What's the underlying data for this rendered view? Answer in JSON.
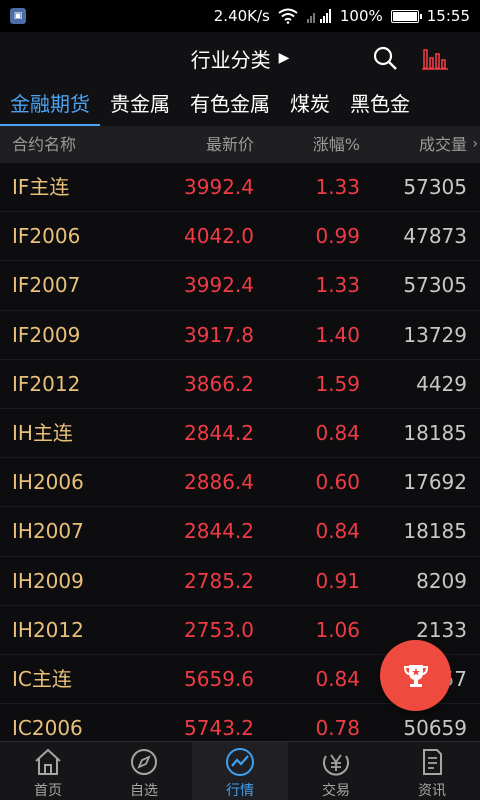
{
  "status_bar": {
    "speed": "2.40K/s",
    "battery": "100%",
    "battery_level": 1.0,
    "time": "15:55",
    "icons": [
      "app-notification-icon",
      "wifi-icon",
      "signal-icon",
      "battery-icon"
    ]
  },
  "title_bar": {
    "title": "行业分类",
    "icons": [
      "search-icon",
      "bar-chart-icon"
    ]
  },
  "tabs": [
    {
      "label": "金融期货",
      "active": true
    },
    {
      "label": "贵金属",
      "active": false
    },
    {
      "label": "有色金属",
      "active": false
    },
    {
      "label": "煤炭",
      "active": false
    },
    {
      "label": "黑色金",
      "active": false
    }
  ],
  "table": {
    "headers": {
      "name": "合约名称",
      "price": "最新价",
      "change": "涨幅%",
      "volume": "成交量"
    },
    "rows": [
      {
        "name": "IF主连",
        "price": "3992.4",
        "change": "1.33",
        "volume": "57305"
      },
      {
        "name": "IF2006",
        "price": "4042.0",
        "change": "0.99",
        "volume": "47873"
      },
      {
        "name": "IF2007",
        "price": "3992.4",
        "change": "1.33",
        "volume": "57305"
      },
      {
        "name": "IF2009",
        "price": "3917.8",
        "change": "1.40",
        "volume": "13729"
      },
      {
        "name": "IF2012",
        "price": "3866.2",
        "change": "1.59",
        "volume": "4429"
      },
      {
        "name": "IH主连",
        "price": "2844.2",
        "change": "0.84",
        "volume": "18185"
      },
      {
        "name": "IH2006",
        "price": "2886.4",
        "change": "0.60",
        "volume": "17692"
      },
      {
        "name": "IH2007",
        "price": "2844.2",
        "change": "0.84",
        "volume": "18185"
      },
      {
        "name": "IH2009",
        "price": "2785.2",
        "change": "0.91",
        "volume": "8209"
      },
      {
        "name": "IH2012",
        "price": "2753.0",
        "change": "1.06",
        "volume": "2133"
      },
      {
        "name": "IC主连",
        "price": "5659.6",
        "change": "0.84",
        "volume": "57"
      },
      {
        "name": "IC2006",
        "price": "5743.2",
        "change": "0.78",
        "volume": "50659"
      }
    ]
  },
  "fab": {
    "icon": "trophy-icon"
  },
  "nav": [
    {
      "label": "首页",
      "icon": "home-icon",
      "active": false
    },
    {
      "label": "自选",
      "icon": "compass-icon",
      "active": false
    },
    {
      "label": "行情",
      "icon": "trend-chart-icon",
      "active": true
    },
    {
      "label": "交易",
      "icon": "yen-icon",
      "active": false
    },
    {
      "label": "资讯",
      "icon": "document-icon",
      "active": false
    }
  ],
  "colors": {
    "accent": "#4aa3f0",
    "up": "#ef3b45",
    "name": "#e8c07a",
    "fab": "#ef4a3e"
  }
}
